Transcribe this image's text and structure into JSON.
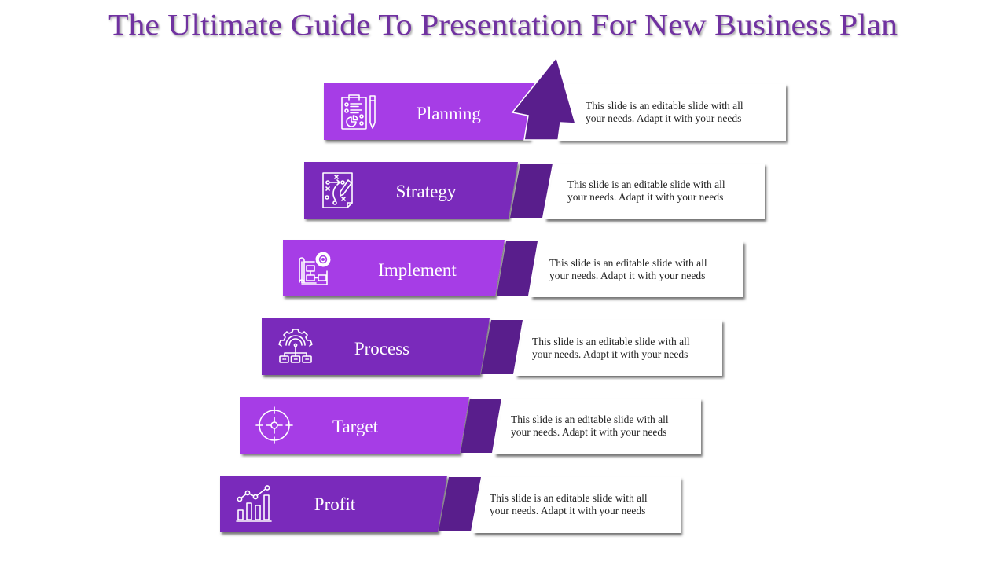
{
  "title": "The Ultimate Guide To Presentation For New Business Plan",
  "colors": {
    "title": "#7030A0",
    "light_purple": "#A63DE6",
    "dark_purple": "#7A2BBB",
    "band": "#591E8C",
    "box": "#FFFFFF",
    "description_text": "#222222"
  },
  "steps": [
    {
      "label": "Planning",
      "icon": "clipboard-pen-icon",
      "description": [
        "This slide is an editable slide with all",
        "your needs. Adapt it with your needs"
      ]
    },
    {
      "label": "Strategy",
      "icon": "strategy-plan-icon",
      "description": [
        "This slide is an editable slide with all",
        "your needs. Adapt it with your needs"
      ]
    },
    {
      "label": "Implement",
      "icon": "blueprint-gear-icon",
      "description": [
        "This slide is an editable slide with all",
        "your needs. Adapt it with your needs"
      ]
    },
    {
      "label": "Process",
      "icon": "gear-network-icon",
      "description": [
        "This slide is an editable slide with all",
        "your needs. Adapt it with your needs"
      ]
    },
    {
      "label": "Target",
      "icon": "target-crosshair-icon",
      "description": [
        "This slide is an editable slide with all",
        "your needs. Adapt it with your needs"
      ]
    },
    {
      "label": "Profit",
      "icon": "growth-chart-icon",
      "description": [
        "This slide is an editable slide with all",
        "your needs. Adapt it with your needs"
      ]
    }
  ]
}
